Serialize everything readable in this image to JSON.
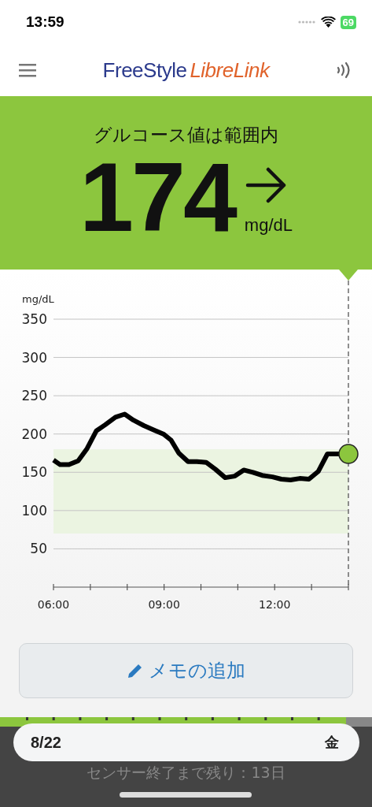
{
  "status_bar": {
    "time": "13:59",
    "battery": "69"
  },
  "header": {
    "logo_primary": "FreeStyle",
    "logo_secondary": "LibreLink"
  },
  "glucose": {
    "status": "グルコース値は範囲内",
    "value": "174",
    "unit": "mg/dL"
  },
  "chart": {
    "chart_data": {
      "type": "line",
      "ylabel": "mg/dL",
      "xlim": [
        6,
        14
      ],
      "ylim": [
        0,
        350
      ],
      "xticks": [
        {
          "value": 6,
          "label": "06:00"
        },
        {
          "value": 9,
          "label": "09:00"
        },
        {
          "value": 12,
          "label": "12:00"
        }
      ],
      "yticks": [
        50,
        100,
        150,
        200,
        250,
        300,
        350
      ],
      "x": [
        6.0,
        6.18,
        6.42,
        6.67,
        6.91,
        7.16,
        7.4,
        7.68,
        7.93,
        8.17,
        8.45,
        8.74,
        8.98,
        9.19,
        9.4,
        9.65,
        9.89,
        10.14,
        10.39,
        10.66,
        10.92,
        11.16,
        11.41,
        11.66,
        11.94,
        12.18,
        12.43,
        12.68,
        12.93,
        13.18,
        13.43,
        13.67,
        14.0
      ],
      "grid": true,
      "series": [
        {
          "color": "#000000",
          "values": [
            166,
            160,
            160,
            165,
            181,
            204,
            212,
            222,
            226,
            218,
            211,
            205,
            200,
            192,
            175,
            164,
            164,
            163,
            154,
            143,
            145,
            153,
            150,
            146,
            144,
            141,
            140,
            142,
            141,
            151,
            174,
            174,
            174
          ]
        }
      ],
      "bands": [
        {
          "axis": "y",
          "from": 70,
          "to": 180,
          "color": "#ebf4e1"
        }
      ]
    }
  },
  "memo_button": {
    "label": "メモの追加"
  },
  "date_bar": {
    "date": "8/22",
    "weekday": "金"
  },
  "sensor_notice": "センサー終了まで残り：13日"
}
